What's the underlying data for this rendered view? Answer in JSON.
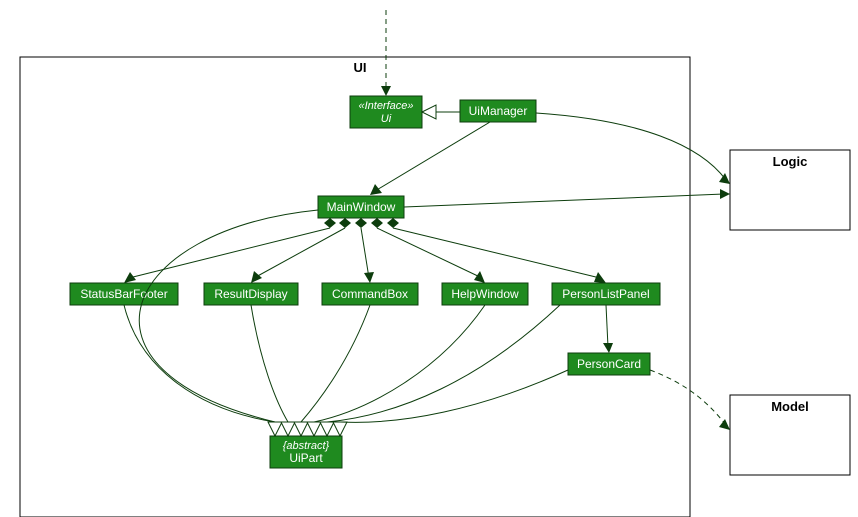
{
  "packages": {
    "ui": {
      "title": "UI"
    },
    "logic": {
      "title": "Logic"
    },
    "model": {
      "title": "Model"
    }
  },
  "nodes": {
    "uiInterface": {
      "stereo": "«Interface»",
      "name": "Ui"
    },
    "uiManager": {
      "name": "UiManager"
    },
    "mainWindow": {
      "name": "MainWindow"
    },
    "statusBarFooter": {
      "name": "StatusBarFooter"
    },
    "resultDisplay": {
      "name": "ResultDisplay"
    },
    "commandBox": {
      "name": "CommandBox"
    },
    "helpWindow": {
      "name": "HelpWindow"
    },
    "personListPanel": {
      "name": "PersonListPanel"
    },
    "personCard": {
      "name": "PersonCard"
    },
    "uiPart": {
      "stereo": "{abstract}",
      "name": "UiPart"
    }
  }
}
